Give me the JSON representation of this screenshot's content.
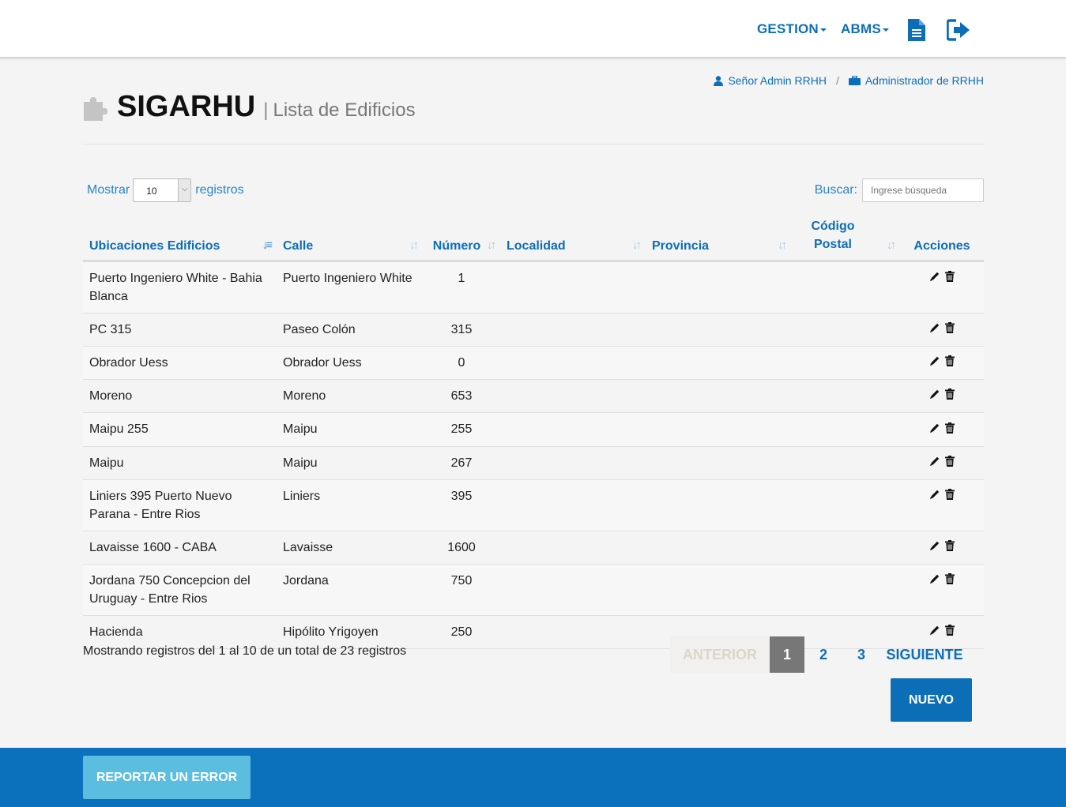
{
  "nav": {
    "gestion_label": "GESTION",
    "abms_label": "ABMS",
    "document_icon": "document-icon",
    "logout_icon": "logout-icon"
  },
  "user": {
    "name": "Señor Admin RRHH",
    "separator": "/",
    "role": "Administrador de RRHH"
  },
  "header": {
    "app_name": "SIGARHU",
    "separator": "|",
    "page_title": "Lista de Edificios"
  },
  "controls": {
    "show_label": "Mostrar",
    "page_size": "10",
    "records_label": "registros",
    "search_label": "Buscar:",
    "search_placeholder": "Ingrese búsqueda"
  },
  "table": {
    "columns": [
      "Ubicaciones Edificios",
      "Calle",
      "Número",
      "Localidad",
      "Provincia",
      "Código Postal",
      "Acciones"
    ],
    "rows": [
      {
        "ubicacion": "Puerto Ingeniero White - Bahia Blanca",
        "calle": "Puerto Ingeniero White",
        "numero": "1",
        "localidad": "",
        "provincia": "",
        "cp": ""
      },
      {
        "ubicacion": "PC 315",
        "calle": "Paseo Colón",
        "numero": "315",
        "localidad": "",
        "provincia": "",
        "cp": ""
      },
      {
        "ubicacion": "Obrador Uess",
        "calle": "Obrador Uess",
        "numero": "0",
        "localidad": "",
        "provincia": "",
        "cp": ""
      },
      {
        "ubicacion": "Moreno",
        "calle": "Moreno",
        "numero": "653",
        "localidad": "",
        "provincia": "",
        "cp": ""
      },
      {
        "ubicacion": "Maipu 255",
        "calle": "Maipu",
        "numero": "255",
        "localidad": "",
        "provincia": "",
        "cp": ""
      },
      {
        "ubicacion": "Maipu",
        "calle": "Maipu",
        "numero": "267",
        "localidad": "",
        "provincia": "",
        "cp": ""
      },
      {
        "ubicacion": "Liniers 395 Puerto Nuevo Parana - Entre Rios",
        "calle": "Liniers",
        "numero": "395",
        "localidad": "",
        "provincia": "",
        "cp": ""
      },
      {
        "ubicacion": "Lavaisse 1600 - CABA",
        "calle": "Lavaisse",
        "numero": "1600",
        "localidad": "",
        "provincia": "",
        "cp": ""
      },
      {
        "ubicacion": "Jordana 750 Concepcion del Uruguay - Entre Rios",
        "calle": "Jordana",
        "numero": "750",
        "localidad": "",
        "provincia": "",
        "cp": ""
      },
      {
        "ubicacion": "Hacienda",
        "calle": "Hipólito Yrigoyen",
        "numero": "250",
        "localidad": "",
        "provincia": "",
        "cp": ""
      }
    ]
  },
  "footer_info": "Mostrando registros del 1 al 10 de un total de 23 registros",
  "pagination": {
    "prev": "ANTERIOR",
    "pages": [
      "1",
      "2",
      "3"
    ],
    "current": "1",
    "next": "SIGUIENTE"
  },
  "new_button": "NUEVO",
  "report_button": "REPORTAR UN ERROR",
  "colors": {
    "brand_blue": "#0d6eb8",
    "footer_blue": "#0b71bd",
    "report_button": "#5bbde0"
  }
}
